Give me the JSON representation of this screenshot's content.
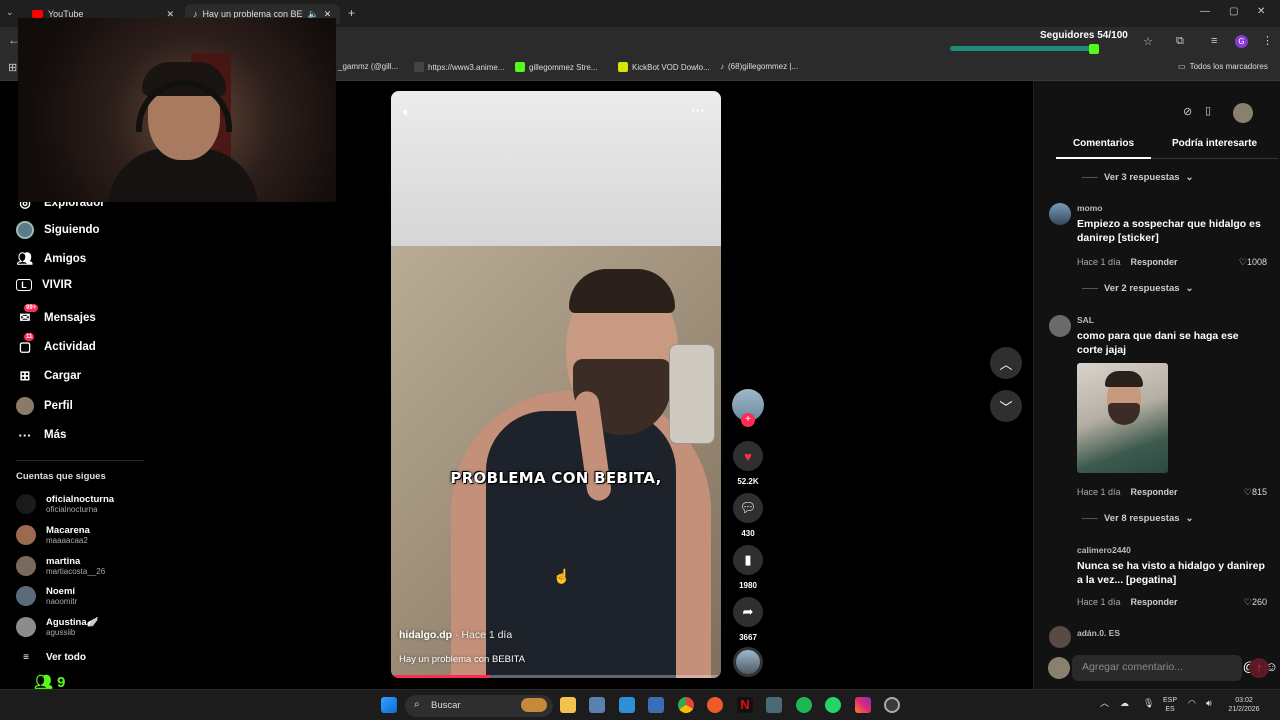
{
  "browser": {
    "tabs": [
      {
        "label": "YouTube",
        "active": false
      },
      {
        "label": "Hay un problema con BEBI",
        "active": true
      }
    ],
    "new_tab": "+",
    "overlay_counter": "Seguidores 54/100",
    "bookmarks": [
      {
        "label": "_gammz (@gill..."
      },
      {
        "label": "https://www3.anime..."
      },
      {
        "label": "gillegommez Stre..."
      },
      {
        "label": "KickBot VOD Dowlo..."
      },
      {
        "label": "(68)gillegommez |..."
      }
    ],
    "all_bookmarks": "Todos los marcadores"
  },
  "sidebar": {
    "items": [
      {
        "label": "Explorador",
        "icon": "compass-icon"
      },
      {
        "label": "Siguiendo",
        "icon": "following-avatar-icon"
      },
      {
        "label": "Amigos",
        "icon": "friends-icon"
      },
      {
        "label": "VIVIR",
        "icon": "live-icon"
      },
      {
        "label": "Mensajes",
        "icon": "messages-icon",
        "badge": "99+"
      },
      {
        "label": "Actividad",
        "icon": "activity-icon",
        "badge": "11"
      },
      {
        "label": "Cargar",
        "icon": "upload-icon"
      },
      {
        "label": "Perfil",
        "icon": "profile-icon"
      },
      {
        "label": "Más",
        "icon": "more-icon"
      }
    ],
    "following_heading": "Cuentas que sigues",
    "following": [
      {
        "name": "oficialnocturna",
        "user": "oficialnocturna"
      },
      {
        "name": "Macarena",
        "user": "maaaacaa2"
      },
      {
        "name": "martina",
        "user": "martiacosta__26"
      },
      {
        "name": "Noemí",
        "user": "naoomitr"
      },
      {
        "name": "Agustina🪽",
        "user": "agussiib"
      }
    ],
    "see_all": "Ver todo",
    "friends_count": "9"
  },
  "video": {
    "caption": "PROBLEMA CON BEBITA,",
    "author": "hidalgo.dp",
    "posted": " · Hace 1 día",
    "description": "Hay un problema con BEBITA",
    "progress": 0.3
  },
  "actions": {
    "likes": "52.2K",
    "comments": "430",
    "saves": "1980",
    "shares": "3667"
  },
  "panel": {
    "tab_comments": "Comentarios",
    "tab_related": "Podría interesarte",
    "replies_3": "Ver 3 respuestas",
    "replies_2": "Ver 2 respuestas",
    "replies_8": "Ver 8 respuestas",
    "comments": [
      {
        "user": "momo",
        "text": "Empiezo a sospechar que hidalgo es danirep [sticker]",
        "time": "Hace 1 día",
        "reply": "Responder",
        "likes": "1008"
      },
      {
        "user": "SAL",
        "text": "como para que dani se haga ese corte jajaj",
        "time": "Hace 1 día",
        "reply": "Responder",
        "likes": "815"
      },
      {
        "user": "calimero2440",
        "text": "Nunca se ha visto a hidalgo y danirep a la vez... [pegatina]",
        "time": "Hace 1 día",
        "reply": "Responder",
        "likes": "260"
      },
      {
        "user": "adán.0. ES"
      }
    ],
    "composer_placeholder": "Agregar comentario..."
  },
  "taskbar": {
    "search": "Buscar",
    "lang_top": "ESP",
    "lang_bottom": "ES",
    "time": "03:02",
    "date": "21/2/2026"
  },
  "colors": {
    "accent": "#fe2c55",
    "panel_bg": "#121212",
    "overlay_bar": "#1b8c7a"
  }
}
